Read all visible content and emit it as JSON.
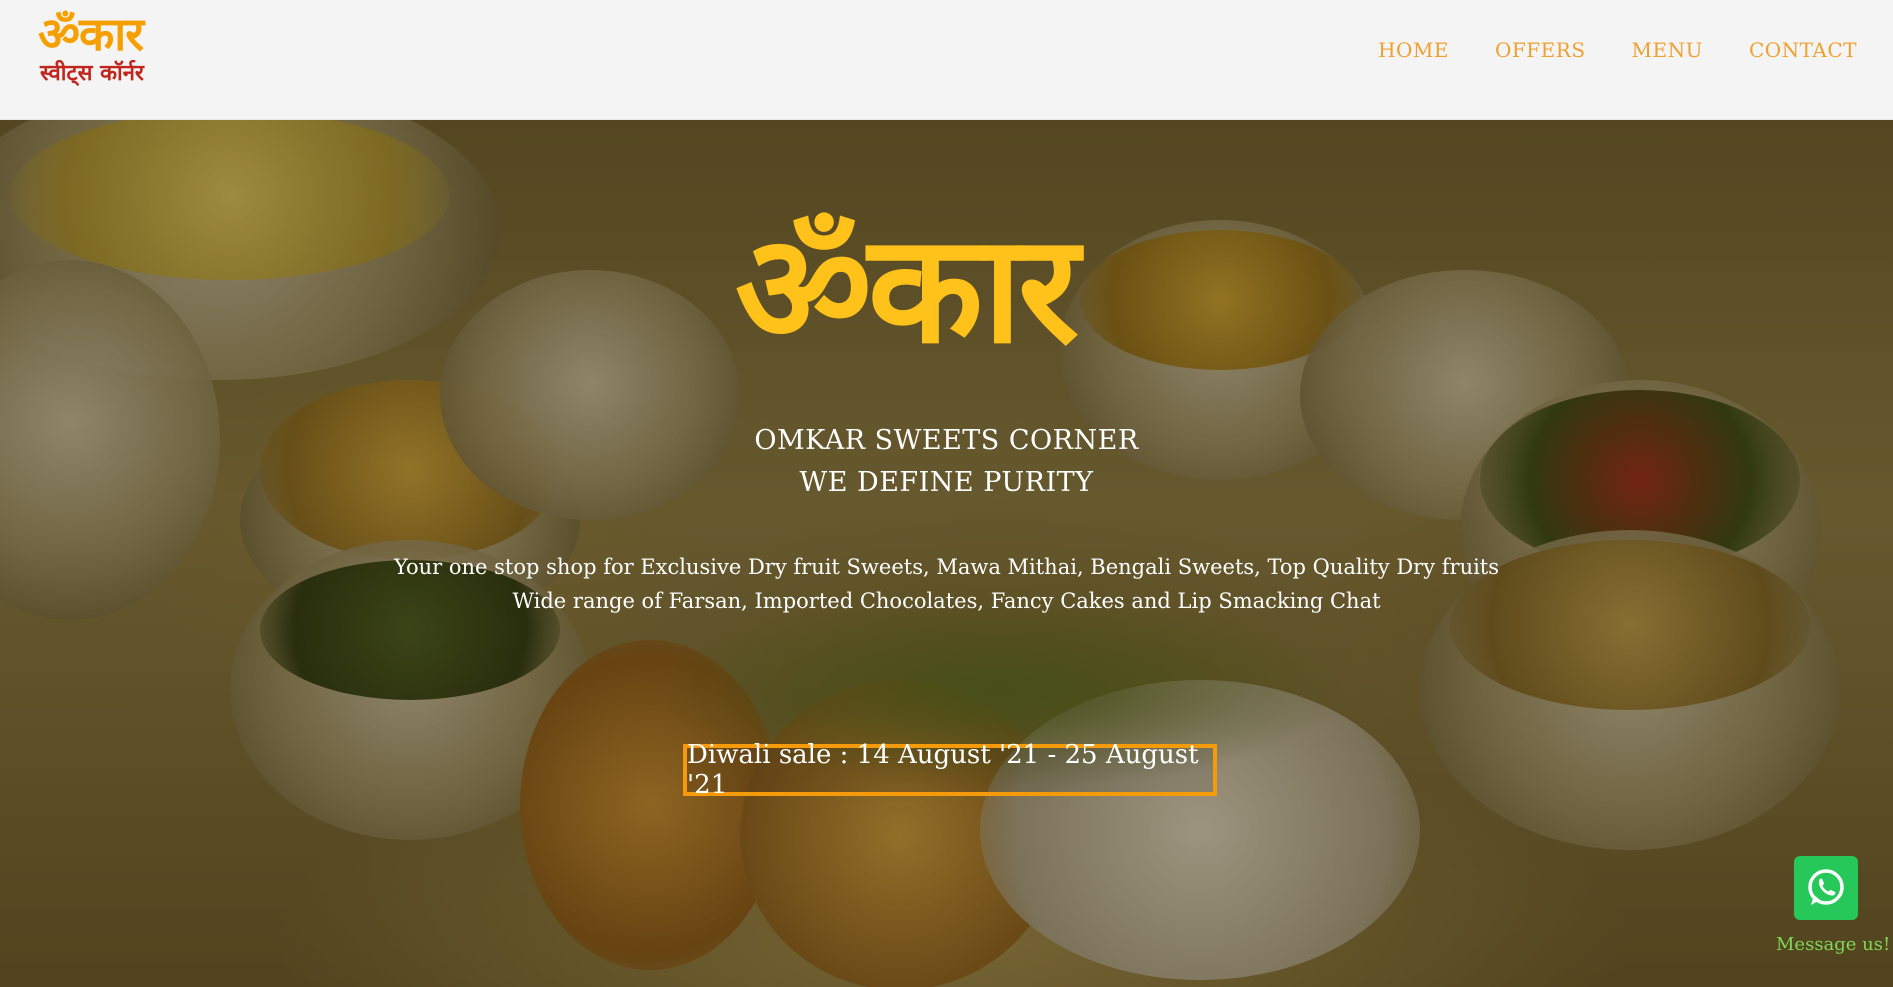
{
  "header": {
    "logo_main": "ॐकार",
    "logo_sub": "स्वीट्स कॉर्नर",
    "nav": [
      "HOME",
      "OFFERS",
      "MENU",
      "CONTACT"
    ]
  },
  "hero": {
    "logo": "ॐकार",
    "title_line1": "OMKAR SWEETS CORNER",
    "title_line2": "WE DEFINE PURITY",
    "desc_line1": "Your one stop shop for Exclusive Dry fruit Sweets, Mawa Mithai, Bengali Sweets, Top Quality Dry fruits",
    "desc_line2": "Wide range of Farsan, Imported Chocolates, Fancy Cakes and Lip Smacking Chat",
    "sale_text": "Diwali sale : 14 August '21 - 25 August '21"
  },
  "whatsapp": {
    "icon": "whatsapp-icon",
    "label": "Message us!"
  },
  "colors": {
    "accent_orange": "#f0a030",
    "logo_yellow": "#ffc21a",
    "logo_red": "#c0261d",
    "sale_border": "#f59a0b",
    "whatsapp_green": "#27c85a"
  }
}
